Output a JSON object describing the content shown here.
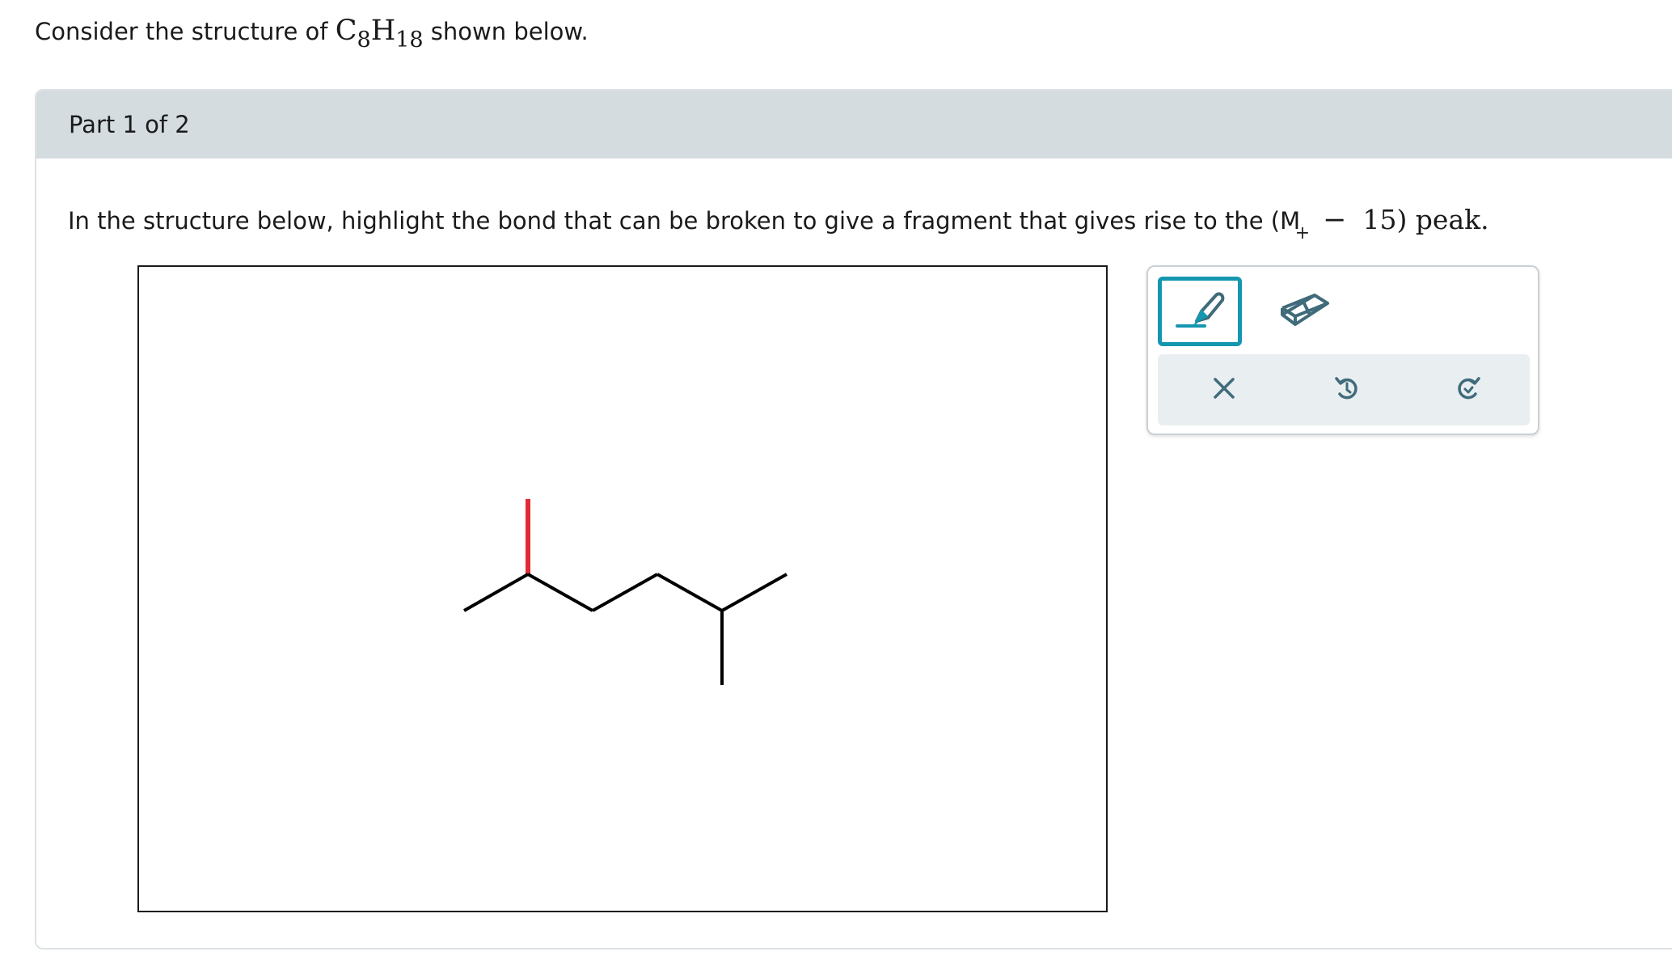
{
  "intro": {
    "prefix": "Consider the structure of ",
    "formula_c": "C",
    "formula_c_sub": "8",
    "formula_h": "H",
    "formula_h_sub": "18",
    "suffix": " shown below."
  },
  "part": {
    "label": "Part 1 of 2"
  },
  "question": {
    "text": "In the structure below, highlight the bond that can be broken to give a fragment that gives rise to the (M",
    "charge": "+",
    "minus": "−",
    "tail": "15) peak."
  },
  "colors": {
    "highlight_bond": "#e02a35",
    "bond": "#000000",
    "active_tool_border": "#1596b0",
    "header_bg": "#d4dce0",
    "icon": "#3f6b7a"
  },
  "toolbox": {
    "tools": [
      {
        "name": "highlighter",
        "icon": "highlighter-icon",
        "active": true
      },
      {
        "name": "eraser",
        "icon": "eraser-icon",
        "active": false
      }
    ],
    "actions": [
      {
        "name": "clear",
        "icon": "close-icon"
      },
      {
        "name": "undo",
        "icon": "undo-icon"
      },
      {
        "name": "redo",
        "icon": "redo-icon"
      }
    ]
  }
}
